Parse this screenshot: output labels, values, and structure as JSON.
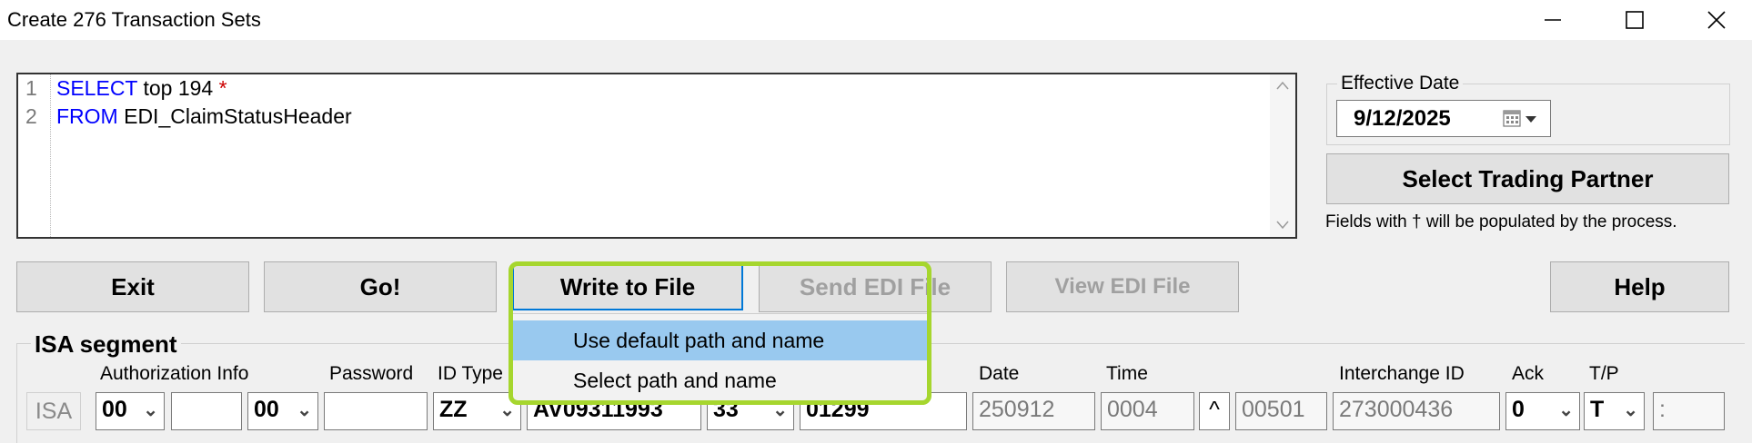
{
  "window": {
    "title": "Create 276 Transaction Sets",
    "controls": [
      "minimize",
      "maximize",
      "close"
    ]
  },
  "editor": {
    "lines": [
      {
        "number": "1",
        "keyword": "SELECT",
        "text": " top 194 ",
        "star": "*"
      },
      {
        "number": "2",
        "keyword": "FROM",
        "text": " EDI_ClaimStatusHeader",
        "star": ""
      }
    ]
  },
  "effective_date": {
    "label": "Effective Date",
    "value": "9/12/2025",
    "icon": "calendar-icon"
  },
  "buttons": {
    "select_trading_partner": "Select Trading Partner",
    "exit": "Exit",
    "go": "Go!",
    "write_to_file": "Write to File",
    "send_edi_file": "Send EDI File",
    "view_edi_file": "View EDI File",
    "help": "Help"
  },
  "note": "Fields with † will be populated by the process.",
  "write_menu": {
    "items": [
      "Use default path and name",
      "Select path and name"
    ],
    "selected_index": 0
  },
  "isa": {
    "section_label": "ISA segment",
    "labels": {
      "authorization_info": "Authorization Info",
      "password": "Password",
      "id_type": "ID Type",
      "date": "Date",
      "time": "Time",
      "interchange_id": "Interchange ID",
      "ack": "Ack",
      "tp": "T/P"
    },
    "fields": {
      "segment": "ISA",
      "auth_qualifier": "00",
      "auth_info": "",
      "password_qualifier": "00",
      "password": "",
      "id_type": "ZZ",
      "sender_id": "AV09311993",
      "receiver_qualifier": "33",
      "receiver_id": "01299",
      "date": "250912",
      "time": "0004",
      "repetition_separator": "^",
      "version": "00501",
      "interchange_id": "273000436",
      "ack": "0",
      "tp": "T",
      "component_separator": ":"
    }
  },
  "colors": {
    "highlight": "#a6d62e",
    "menu_selected": "#99c9ef",
    "keyword": "#0000ff",
    "accent_border": "#0078d7"
  }
}
